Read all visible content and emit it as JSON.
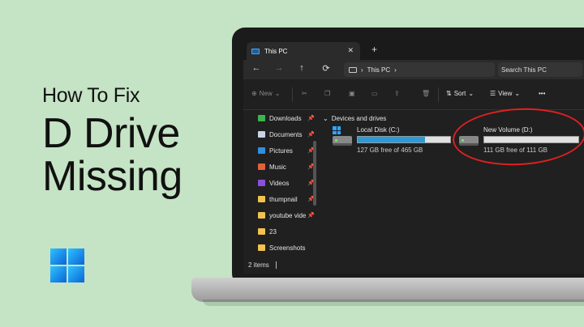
{
  "headline": {
    "line1": "How To Fix",
    "line2": "D Drive",
    "line3": "Missing"
  },
  "explorer": {
    "tab_title": "This PC",
    "tab_close": "✕",
    "tab_add": "+",
    "nav": {
      "back": "←",
      "forward": "→",
      "up": "↑",
      "refresh": "⟳"
    },
    "address": {
      "chevron": "›",
      "location": "This PC"
    },
    "search_placeholder": "Search This PC",
    "toolbar": {
      "new_label": "New",
      "sort_label": "Sort",
      "view_label": "View",
      "more_label": "•••"
    },
    "sidebar": [
      {
        "label": "Downloads",
        "pinned": true,
        "icon": "download-icon",
        "color": "#3fb24f"
      },
      {
        "label": "Documents",
        "pinned": true,
        "icon": "document-icon",
        "color": "#c8d3e6"
      },
      {
        "label": "Pictures",
        "pinned": true,
        "icon": "picture-icon",
        "color": "#2f8fe0"
      },
      {
        "label": "Music",
        "pinned": true,
        "icon": "music-icon",
        "color": "#e0623a"
      },
      {
        "label": "Videos",
        "pinned": true,
        "icon": "video-icon",
        "color": "#8a4fe0"
      },
      {
        "label": "thumpnail",
        "pinned": true,
        "icon": "folder-icon",
        "color": "#f2c14e"
      },
      {
        "label": "youtube vide",
        "pinned": true,
        "icon": "folder-icon",
        "color": "#f2c14e"
      },
      {
        "label": "23",
        "pinned": false,
        "icon": "folder-icon",
        "color": "#f2c14e"
      },
      {
        "label": "Screenshots",
        "pinned": false,
        "icon": "folder-icon",
        "color": "#f2c14e"
      }
    ],
    "pin_glyph": "📌",
    "group_header": "Devices and drives",
    "drives": [
      {
        "name": "Local Disk (C:)",
        "free_text": "127 GB free of 465 GB",
        "used_fraction": 0.73
      },
      {
        "name": "New Volume (D:)",
        "free_text": "111 GB free of 111 GB",
        "used_fraction": 0.0
      }
    ],
    "status": {
      "items": "2 items"
    }
  },
  "colors": {
    "background": "#c5e3c5",
    "accent": "#2a9ad8",
    "highlight": "#e02020"
  }
}
